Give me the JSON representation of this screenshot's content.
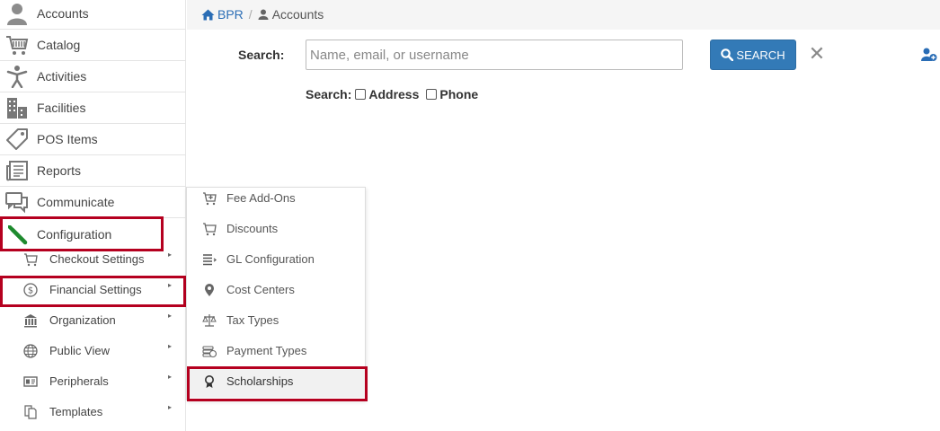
{
  "sidebar": {
    "items": [
      {
        "label": "Accounts",
        "icon": "user-icon"
      },
      {
        "label": "Catalog",
        "icon": "cart-icon"
      },
      {
        "label": "Activities",
        "icon": "person-activity-icon"
      },
      {
        "label": "Facilities",
        "icon": "building-icon"
      },
      {
        "label": "POS Items",
        "icon": "tag-icon"
      },
      {
        "label": "Reports",
        "icon": "newspaper-icon"
      },
      {
        "label": "Communicate",
        "icon": "chat-icon"
      },
      {
        "label": "Configuration",
        "icon": "wrench-icon"
      }
    ],
    "sub_items": [
      {
        "label": "Checkout Settings",
        "icon": "cart-small-icon"
      },
      {
        "label": "Financial Settings",
        "icon": "dollar-circle-icon"
      },
      {
        "label": "Organization",
        "icon": "bank-icon"
      },
      {
        "label": "Public View",
        "icon": "globe-icon"
      },
      {
        "label": "Peripherals",
        "icon": "id-card-icon"
      },
      {
        "label": "Templates",
        "icon": "copy-icon"
      }
    ],
    "submenu_arrow": "▸"
  },
  "breadcrumb": {
    "home": "BPR",
    "separator": "/",
    "current": "Accounts"
  },
  "search": {
    "label": "Search:",
    "placeholder": "Name, email, or username",
    "value": "",
    "button_label": "SEARCH",
    "clear_glyph": "✕",
    "options_label": "Search:",
    "options": [
      {
        "label": "Address",
        "checked": false
      },
      {
        "label": "Phone",
        "checked": false
      }
    ]
  },
  "flyout": {
    "items": [
      {
        "label": "Fee Add-Ons",
        "icon": "cart-plus-icon"
      },
      {
        "label": "Discounts",
        "icon": "cart-icon"
      },
      {
        "label": "GL Configuration",
        "icon": "list-icon"
      },
      {
        "label": "Cost Centers",
        "icon": "map-marker-icon"
      },
      {
        "label": "Tax Types",
        "icon": "scale-icon"
      },
      {
        "label": "Payment Types",
        "icon": "cash-icon"
      },
      {
        "label": "Scholarships",
        "icon": "award-icon"
      }
    ]
  },
  "colors": {
    "highlight": "#b5001f",
    "primary": "#337ab7",
    "link": "#2a6db5",
    "wrench": "#1e8a2e"
  }
}
